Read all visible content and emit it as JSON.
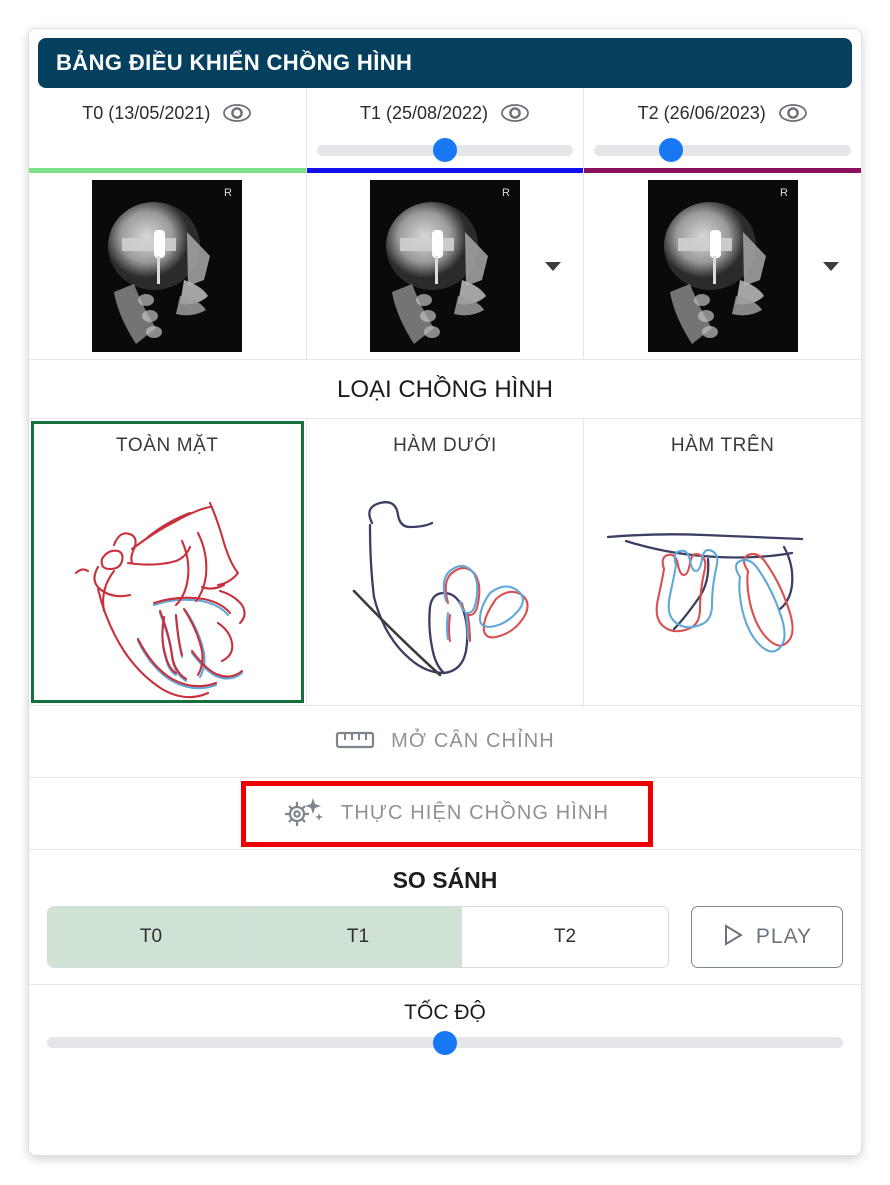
{
  "header": {
    "title": "BẢNG ĐIỀU KHIỂN CHỒNG HÌNH"
  },
  "timepoints": [
    {
      "label": "T0 (13/05/2021)",
      "eye_icon": "eye-icon",
      "color": "#7fe08a",
      "has_slider": false,
      "slider_value": null,
      "has_caret": false
    },
    {
      "label": "T1 (25/08/2022)",
      "eye_icon": "eye-icon",
      "color": "#1111ee",
      "has_slider": true,
      "slider_value": 50,
      "has_caret": true
    },
    {
      "label": "T2 (26/06/2023)",
      "eye_icon": "eye-icon",
      "color": "#8b1160",
      "has_slider": true,
      "slider_value": 30,
      "has_caret": true
    }
  ],
  "types_section": {
    "title": "LOẠI CHỒNG HÌNH",
    "selected_index": 0,
    "selected_border_color": "#15703d",
    "items": [
      {
        "label": "TOÀN MẶT",
        "tracing": "full-face-tracing"
      },
      {
        "label": "HÀM DƯỚI",
        "tracing": "mandible-tracing"
      },
      {
        "label": "HÀM TRÊN",
        "tracing": "maxilla-tracing"
      }
    ]
  },
  "actions": {
    "open_align": {
      "label": "MỞ CÂN CHỈNH",
      "icon": "ruler-icon"
    },
    "run_superimposition": {
      "label": "THỰC HIỆN CHỒNG HÌNH",
      "icon": "gear-sparkle-icon",
      "highlight_color": "#ee0000"
    }
  },
  "compare": {
    "title": "SO SÁNH",
    "segments": [
      {
        "label": "T0",
        "selected": true
      },
      {
        "label": "T1",
        "selected": true
      },
      {
        "label": "T2",
        "selected": false
      }
    ],
    "selected_bg": "#cfe2d4",
    "play": {
      "label": "PLAY",
      "icon": "play-triangle-icon"
    }
  },
  "speed": {
    "title": "TỐC ĐỘ",
    "slider_value": 50
  }
}
